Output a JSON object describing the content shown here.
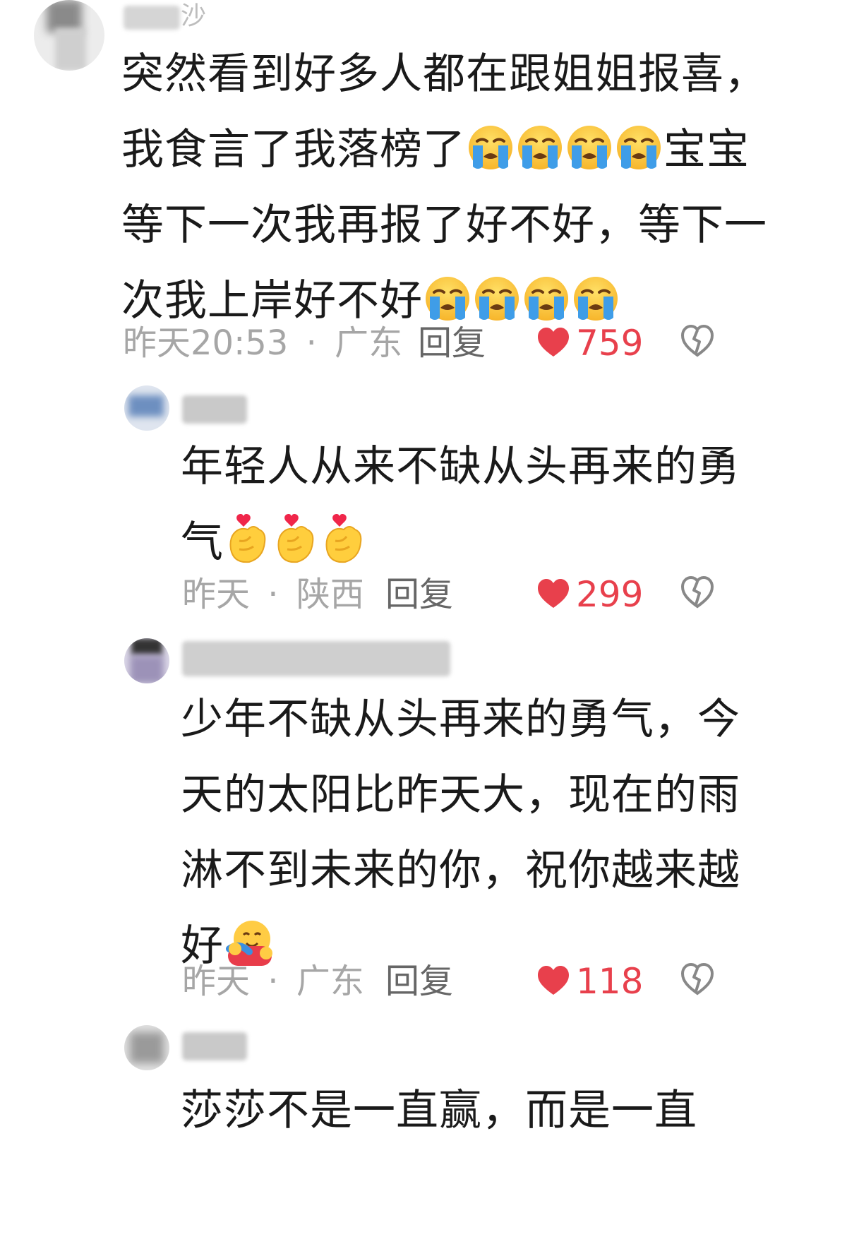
{
  "comments": [
    {
      "username_partial": "沙",
      "lines": [
        "突然看到好多人都在跟姐姐报喜，",
        "我食言了我落榜了",
        "等下一次我再报了好不好，等下一",
        "次我上岸好不好"
      ],
      "line2_tail": "宝宝",
      "emoji_crying": "crying-face-icon",
      "time": "昨天20:53",
      "location": "广东",
      "reply_label": "回复",
      "likes": "759"
    },
    {
      "lines": [
        "年轻人从来不缺从头再来的勇",
        "气"
      ],
      "emoji_heart_hand": "finger-heart-icon",
      "time": "昨天",
      "location": "陕西",
      "reply_label": "回复",
      "likes": "299"
    },
    {
      "lines": [
        "少年不缺从头再来的勇气，今",
        "天的太阳比昨天大，现在的雨",
        "淋不到未来的你，祝你越来越",
        "好"
      ],
      "emoji_hug": "hugging-face-icon",
      "time": "昨天",
      "location": "广东",
      "reply_label": "回复",
      "likes": "118"
    },
    {
      "lines": [
        "莎莎不是一直赢，而是一直"
      ]
    }
  ],
  "separator": "·",
  "colors": {
    "like_red": "#e8404c",
    "meta_gray": "#a6a6a6",
    "reply_gray": "#666666"
  }
}
